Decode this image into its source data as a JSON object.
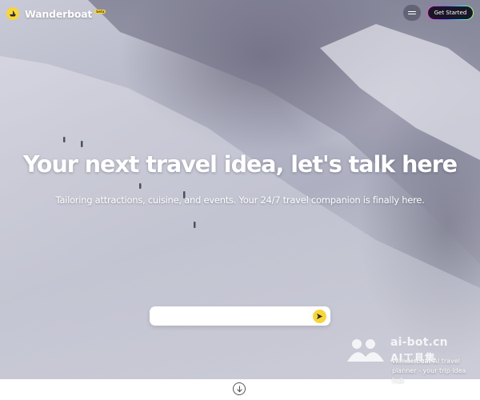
{
  "brand": {
    "name": "Wanderboat",
    "badge": "beta",
    "accent": "#f7d53c"
  },
  "header": {
    "menu_icon": "hamburger-icon",
    "cta_label": "Get Started"
  },
  "hero": {
    "headline": "Your next travel idea, let's talk here",
    "subline": "Tailoring attractions, cuisine, and events. Your 24/7 travel companion is finally here."
  },
  "search": {
    "placeholder": "",
    "submit_icon": "send-arrow-icon"
  },
  "watermark": {
    "line1": "ai-bot.cn",
    "line2": "AI工具集"
  },
  "promo": {
    "text": "Wanderboat-AI travel planner - your trip idea hub"
  },
  "footer": {
    "scroll_icon": "arrow-down-circle-icon"
  }
}
